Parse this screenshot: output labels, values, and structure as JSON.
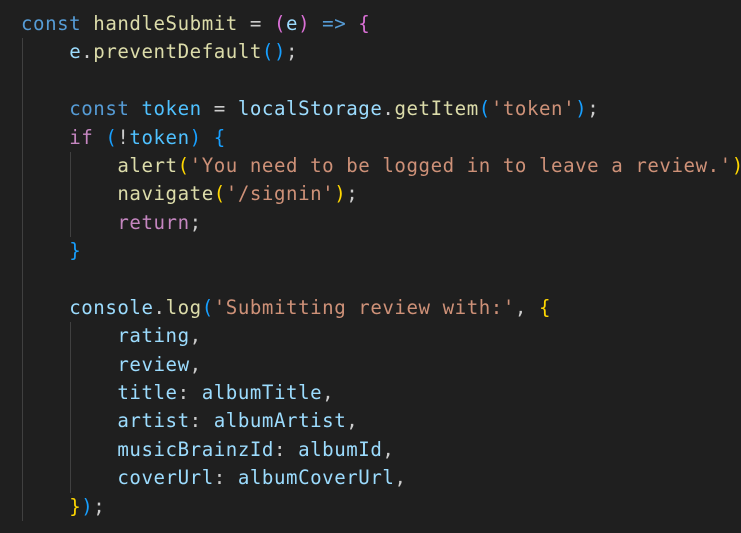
{
  "editor": {
    "theme": {
      "background": "#1f1f1f",
      "indent_guide": "#404040",
      "keyword": "#569cd6",
      "control": "#c586c0",
      "function": "#dcdcaa",
      "variable": "#9cdcfe",
      "constant": "#4fc1ff",
      "string": "#ce9178",
      "punctuation": "#cccccc",
      "bracket_gold": "#ffd700",
      "bracket_pink": "#da70d6",
      "bracket_blue": "#179fff"
    },
    "lines": [
      {
        "indent": 0,
        "tokens": [
          {
            "t": "const",
            "c": "keyword"
          },
          {
            "t": " ",
            "c": "punctuation"
          },
          {
            "t": "handleSubmit",
            "c": "function"
          },
          {
            "t": " = ",
            "c": "punctuation"
          },
          {
            "t": "(",
            "c": "bracket_pink"
          },
          {
            "t": "e",
            "c": "variable"
          },
          {
            "t": ")",
            "c": "bracket_pink"
          },
          {
            "t": " ",
            "c": "punctuation"
          },
          {
            "t": "=>",
            "c": "keyword"
          },
          {
            "t": " ",
            "c": "punctuation"
          },
          {
            "t": "{",
            "c": "bracket_pink"
          }
        ]
      },
      {
        "indent": 1,
        "tokens": [
          {
            "t": "e",
            "c": "variable"
          },
          {
            "t": ".",
            "c": "punctuation"
          },
          {
            "t": "preventDefault",
            "c": "function"
          },
          {
            "t": "()",
            "c": "bracket_blue"
          },
          {
            "t": ";",
            "c": "punctuation"
          }
        ]
      },
      {
        "indent": 1,
        "tokens": []
      },
      {
        "indent": 1,
        "tokens": [
          {
            "t": "const",
            "c": "keyword"
          },
          {
            "t": " ",
            "c": "punctuation"
          },
          {
            "t": "token",
            "c": "constant"
          },
          {
            "t": " = ",
            "c": "punctuation"
          },
          {
            "t": "localStorage",
            "c": "variable"
          },
          {
            "t": ".",
            "c": "punctuation"
          },
          {
            "t": "getItem",
            "c": "function"
          },
          {
            "t": "(",
            "c": "bracket_blue"
          },
          {
            "t": "'token'",
            "c": "string"
          },
          {
            "t": ")",
            "c": "bracket_blue"
          },
          {
            "t": ";",
            "c": "punctuation"
          }
        ]
      },
      {
        "indent": 1,
        "tokens": [
          {
            "t": "if",
            "c": "control"
          },
          {
            "t": " ",
            "c": "punctuation"
          },
          {
            "t": "(",
            "c": "bracket_blue"
          },
          {
            "t": "!",
            "c": "punctuation"
          },
          {
            "t": "token",
            "c": "constant"
          },
          {
            "t": ")",
            "c": "bracket_blue"
          },
          {
            "t": " ",
            "c": "punctuation"
          },
          {
            "t": "{",
            "c": "bracket_blue"
          }
        ]
      },
      {
        "indent": 2,
        "tokens": [
          {
            "t": "alert",
            "c": "function"
          },
          {
            "t": "(",
            "c": "bracket_gold"
          },
          {
            "t": "'You need to be logged in to leave a review.'",
            "c": "string"
          },
          {
            "t": ")",
            "c": "bracket_gold"
          },
          {
            "t": ";",
            "c": "punctuation"
          }
        ]
      },
      {
        "indent": 2,
        "tokens": [
          {
            "t": "navigate",
            "c": "function"
          },
          {
            "t": "(",
            "c": "bracket_gold"
          },
          {
            "t": "'/signin'",
            "c": "string"
          },
          {
            "t": ")",
            "c": "bracket_gold"
          },
          {
            "t": ";",
            "c": "punctuation"
          }
        ]
      },
      {
        "indent": 2,
        "tokens": [
          {
            "t": "return",
            "c": "control"
          },
          {
            "t": ";",
            "c": "punctuation"
          }
        ]
      },
      {
        "indent": 1,
        "tokens": [
          {
            "t": "}",
            "c": "bracket_blue"
          }
        ]
      },
      {
        "indent": 1,
        "tokens": []
      },
      {
        "indent": 1,
        "tokens": [
          {
            "t": "console",
            "c": "variable"
          },
          {
            "t": ".",
            "c": "punctuation"
          },
          {
            "t": "log",
            "c": "function"
          },
          {
            "t": "(",
            "c": "bracket_blue"
          },
          {
            "t": "'Submitting review with:'",
            "c": "string"
          },
          {
            "t": ", ",
            "c": "punctuation"
          },
          {
            "t": "{",
            "c": "bracket_gold"
          }
        ]
      },
      {
        "indent": 2,
        "tokens": [
          {
            "t": "rating",
            "c": "variable"
          },
          {
            "t": ",",
            "c": "punctuation"
          }
        ]
      },
      {
        "indent": 2,
        "tokens": [
          {
            "t": "review",
            "c": "variable"
          },
          {
            "t": ",",
            "c": "punctuation"
          }
        ]
      },
      {
        "indent": 2,
        "tokens": [
          {
            "t": "title",
            "c": "variable"
          },
          {
            "t": ": ",
            "c": "punctuation"
          },
          {
            "t": "albumTitle",
            "c": "variable"
          },
          {
            "t": ",",
            "c": "punctuation"
          }
        ]
      },
      {
        "indent": 2,
        "tokens": [
          {
            "t": "artist",
            "c": "variable"
          },
          {
            "t": ": ",
            "c": "punctuation"
          },
          {
            "t": "albumArtist",
            "c": "variable"
          },
          {
            "t": ",",
            "c": "punctuation"
          }
        ]
      },
      {
        "indent": 2,
        "tokens": [
          {
            "t": "musicBrainzId",
            "c": "variable"
          },
          {
            "t": ": ",
            "c": "punctuation"
          },
          {
            "t": "albumId",
            "c": "variable"
          },
          {
            "t": ",",
            "c": "punctuation"
          }
        ]
      },
      {
        "indent": 2,
        "tokens": [
          {
            "t": "coverUrl",
            "c": "variable"
          },
          {
            "t": ": ",
            "c": "punctuation"
          },
          {
            "t": "albumCoverUrl",
            "c": "variable"
          },
          {
            "t": ",",
            "c": "punctuation"
          }
        ]
      },
      {
        "indent": 1,
        "tokens": [
          {
            "t": "}",
            "c": "bracket_gold"
          },
          {
            "t": ")",
            "c": "bracket_blue"
          },
          {
            "t": ";",
            "c": "punctuation"
          }
        ]
      }
    ]
  }
}
